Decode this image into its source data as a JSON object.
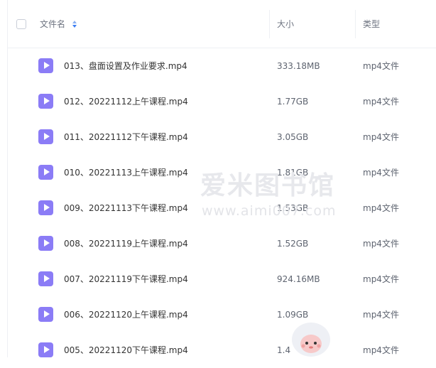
{
  "header": {
    "name_label": "文件名",
    "size_label": "大小",
    "type_label": "类型"
  },
  "files": [
    {
      "name": "013、盘面设置及作业要求.mp4",
      "size": "333.18MB",
      "type": "mp4文件"
    },
    {
      "name": "012、20221112上午课程.mp4",
      "size": "1.77GB",
      "type": "mp4文件"
    },
    {
      "name": "011、20221112下午课程.mp4",
      "size": "3.05GB",
      "type": "mp4文件"
    },
    {
      "name": "010、20221113上午课程.mp4",
      "size": "1.81GB",
      "type": "mp4文件"
    },
    {
      "name": "009、20221113下午课程.mp4",
      "size": "1.53GB",
      "type": "mp4文件"
    },
    {
      "name": "008、20221119上午课程.mp4",
      "size": "1.52GB",
      "type": "mp4文件"
    },
    {
      "name": "007、20221119下午课程.mp4",
      "size": "924.16MB",
      "type": "mp4文件"
    },
    {
      "name": "006、20221120上午课程.mp4",
      "size": "1.09GB",
      "type": "mp4文件"
    },
    {
      "name": "005、20221120下午课程.mp4",
      "size": "1.4",
      "type": "mp4文件"
    }
  ],
  "watermark": {
    "title": "爱米图书馆",
    "url": "www.aimi007.com"
  },
  "icons": {
    "file_icon": "video-file-icon",
    "sort_icon": "sort-icon"
  },
  "colors": {
    "file_icon": "#8b7cf6",
    "sort_active": "#3c7ef4"
  }
}
